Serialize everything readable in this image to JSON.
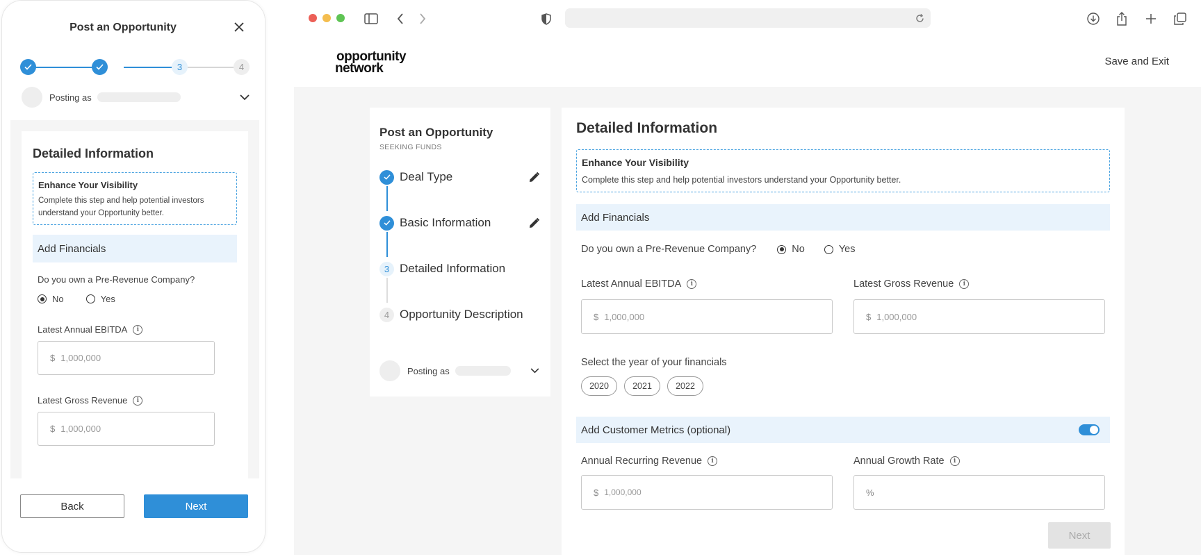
{
  "mobile": {
    "title": "Post an Opportunity",
    "steps": [
      "3",
      "4"
    ],
    "posting_label": "Posting as",
    "section_title": "Detailed Information",
    "visibility": {
      "title": "Enhance Your Visibility",
      "text": "Complete this step and help potential investors understand your Opportunity better."
    },
    "financials_title": "Add Financials",
    "question": "Do you own a Pre-Revenue Company?",
    "radio_no": "No",
    "radio_yes": "Yes",
    "selected": "No",
    "ebitda_label": "Latest Annual EBITDA",
    "ebitda_placeholder": "1,000,000",
    "revenue_label": "Latest Gross Revenue",
    "revenue_placeholder": "1,000,000",
    "currency": "$",
    "back": "Back",
    "next": "Next"
  },
  "browser": {
    "logo_line1": "opportunity",
    "logo_line2": "network",
    "save_exit": "Save and Exit"
  },
  "sidebar": {
    "title": "Post an Opportunity",
    "subtitle": "SEEKING FUNDS",
    "steps": [
      {
        "num": "",
        "label": "Deal Type",
        "state": "done"
      },
      {
        "num": "",
        "label": "Basic Information",
        "state": "done"
      },
      {
        "num": "3",
        "label": "Detailed Information",
        "state": "current"
      },
      {
        "num": "4",
        "label": "Opportunity Description",
        "state": "todo"
      }
    ],
    "posting_label": "Posting as"
  },
  "main": {
    "title": "Detailed Information",
    "visibility": {
      "title": "Enhance Your Visibility",
      "text": "Complete this step and help potential investors understand your Opportunity better."
    },
    "financials_title": "Add Financials",
    "question": "Do you own a Pre-Revenue Company?",
    "radio_no": "No",
    "radio_yes": "Yes",
    "selected": "No",
    "ebitda_label": "Latest Annual EBITDA",
    "ebitda_placeholder": "1,000,000",
    "revenue_label": "Latest Gross Revenue",
    "revenue_placeholder": "1,000,000",
    "currency": "$",
    "year_label": "Select the year of your financials",
    "years": [
      "2020",
      "2021",
      "2022"
    ],
    "customer_metrics_title": "Add Customer Metrics (optional)",
    "customer_metrics_enabled": true,
    "arr_label": "Annual Recurring Revenue",
    "arr_placeholder": "1,000,000",
    "growth_label": "Annual Growth Rate",
    "percent": "%",
    "next": "Next"
  },
  "colors": {
    "accent": "#2f8fd8",
    "accent_light": "#e9f3fc",
    "background": "#f5f5f5"
  }
}
